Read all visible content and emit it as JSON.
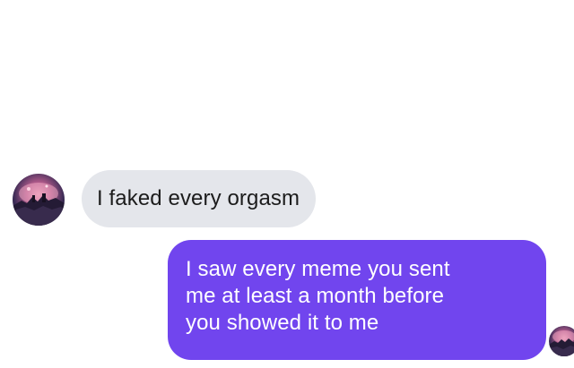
{
  "conversation": {
    "received_message": {
      "text": "I faked every orgasm"
    },
    "sent_message": {
      "lines": [
        "I saw every meme you sent",
        "me at least a month before",
        "you showed it to me"
      ]
    }
  },
  "colors": {
    "background": "#ffffff",
    "received_bubble": "#e4e6eb",
    "received_text": "#1c1c1c",
    "sent_bubble": "#7145ee",
    "sent_text": "#ffffff"
  },
  "icons": {
    "contact_avatar": "avatar-icon",
    "read_receipt_avatar": "avatar-icon"
  }
}
